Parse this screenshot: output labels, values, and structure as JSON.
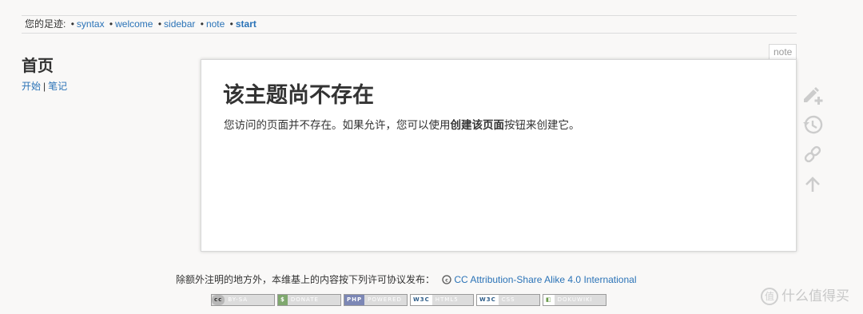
{
  "breadcrumbs": {
    "label": "您的足迹:",
    "sep": "•",
    "items": [
      "syntax",
      "welcome",
      "sidebar",
      "note"
    ],
    "current": "start"
  },
  "sidebar": {
    "title": "首页",
    "link1": "开始",
    "pipe": "|",
    "link2": "笔记"
  },
  "page": {
    "id_tab": "note",
    "heading": "该主题尚不存在",
    "msg_before": "您访问的页面并不存在。如果允许，您可以使用",
    "msg_bold": "创建该页面",
    "msg_after": "按钮来创建它。"
  },
  "tools": [
    "create-page-icon",
    "old-revisions-icon",
    "backlinks-icon",
    "back-to-top-icon"
  ],
  "footer": {
    "license_text": "除额外注明的地方外，本维基上的内容按下列许可协议发布：",
    "license_link": "CC Attribution-Share Alike 4.0 International",
    "badges": [
      {
        "left": "cc",
        "right": "BY-SA"
      },
      {
        "left": "$",
        "right": "DONATE"
      },
      {
        "left": "PHP",
        "right": "POWERED"
      },
      {
        "left": "W3C",
        "right": "HTML5"
      },
      {
        "left": "W3C",
        "right": "CSS"
      },
      {
        "left": "◧",
        "right": "DOKUWIKI"
      }
    ]
  },
  "watermark": {
    "circle": "值",
    "text": "什么值得买"
  },
  "colors": {
    "link": "#2b73b7",
    "icon": "#cccccc",
    "background": "#f9f8f7"
  }
}
